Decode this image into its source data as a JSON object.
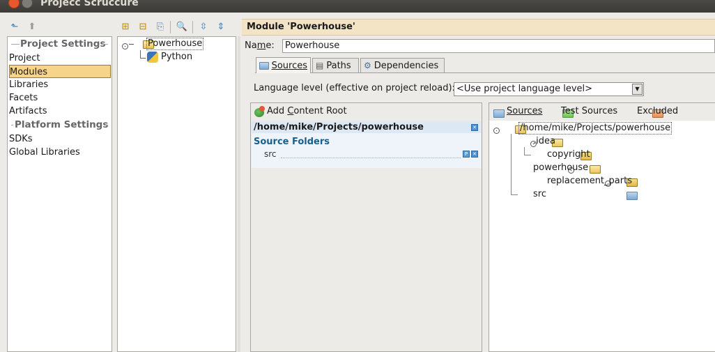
{
  "window": {
    "title": "Projecc Scruccure"
  },
  "left_panel": {
    "section_project_settings": "Project Settings",
    "items_project": [
      "Project",
      "Modules",
      "Libraries",
      "Facets",
      "Artifacts"
    ],
    "section_platform_settings": "Platform Settings",
    "items_platform": [
      "SDKs",
      "Global Libraries"
    ],
    "selected": "Modules"
  },
  "module_tree": {
    "root": "Powerhouse",
    "child": "Python"
  },
  "header": {
    "title": "Module 'Powerhouse'"
  },
  "name_field": {
    "label": "Name:",
    "value": "Powerhouse"
  },
  "tabs": [
    {
      "label": "Sources",
      "icon": "folder-icon"
    },
    {
      "label": "Paths",
      "icon": "paths-icon"
    },
    {
      "label": "Dependencies",
      "icon": "dependencies-icon"
    }
  ],
  "language_level": {
    "label": "Language level (effective on project reload):",
    "value": "<Use project language level>"
  },
  "content_roots": {
    "add_button": "Add Content Root",
    "root_path": "/home/mike/Projects/powerhouse",
    "source_folders_title": "Source Folders",
    "source_folders": [
      "src"
    ]
  },
  "marks": {
    "sources": "Sources",
    "test_sources": "Test Sources",
    "excluded": "Excluded"
  },
  "file_tree": {
    "root": "/home/mike/Projects/powerhouse",
    "idea": ".idea",
    "copyright": "copyright",
    "powerhouse": "powerhouse",
    "replacement_parts": "replacement_parts",
    "src": "src"
  },
  "colors": {
    "selection": "#f6d58a",
    "header_band": "#f3e4c6",
    "content_root_band": "#dce9f5",
    "source_folder_title": "#1a5e8c"
  }
}
